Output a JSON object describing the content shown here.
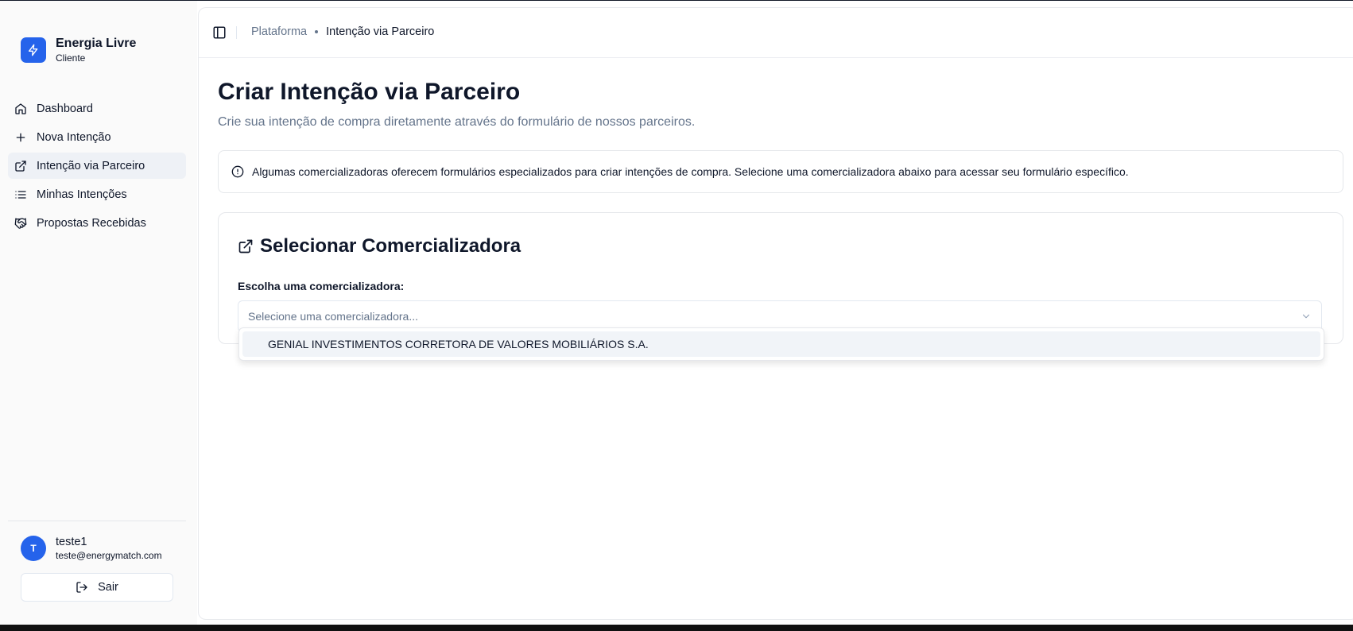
{
  "app": {
    "name": "Energia Livre",
    "role": "Cliente"
  },
  "sidebar": {
    "items": [
      {
        "label": "Dashboard",
        "icon": "home-icon"
      },
      {
        "label": "Nova Intenção",
        "icon": "plus-icon"
      },
      {
        "label": "Intenção via Parceiro",
        "icon": "external-link-icon",
        "active": true
      },
      {
        "label": "Minhas Intenções",
        "icon": "list-icon"
      },
      {
        "label": "Propostas Recebidas",
        "icon": "handshake-icon"
      }
    ]
  },
  "user": {
    "initial": "T",
    "name": "teste1",
    "email": "teste@energymatch.com",
    "logout_label": "Sair"
  },
  "header": {
    "breadcrumb_root": "Plataforma",
    "breadcrumb_current": "Intenção via Parceiro"
  },
  "page": {
    "title": "Criar Intenção via Parceiro",
    "subtitle": "Crie sua intenção de compra diretamente através do formulário de nossos parceiros.",
    "alert": "Algumas comercializadoras oferecem formulários especializados para criar intenções de compra. Selecione uma comercializadora abaixo para acessar seu formulário específico."
  },
  "card": {
    "title": "Selecionar Comercializadora",
    "field_label": "Escolha uma comercializadora:",
    "select_placeholder": "Selecione uma comercializadora...",
    "options": [
      "GENIAL INVESTIMENTOS CORRETORA DE VALORES MOBILIÁRIOS S.A."
    ]
  },
  "colors": {
    "accent": "#2563eb",
    "active_bg": "#eef1f6",
    "muted_text": "#64748b"
  }
}
